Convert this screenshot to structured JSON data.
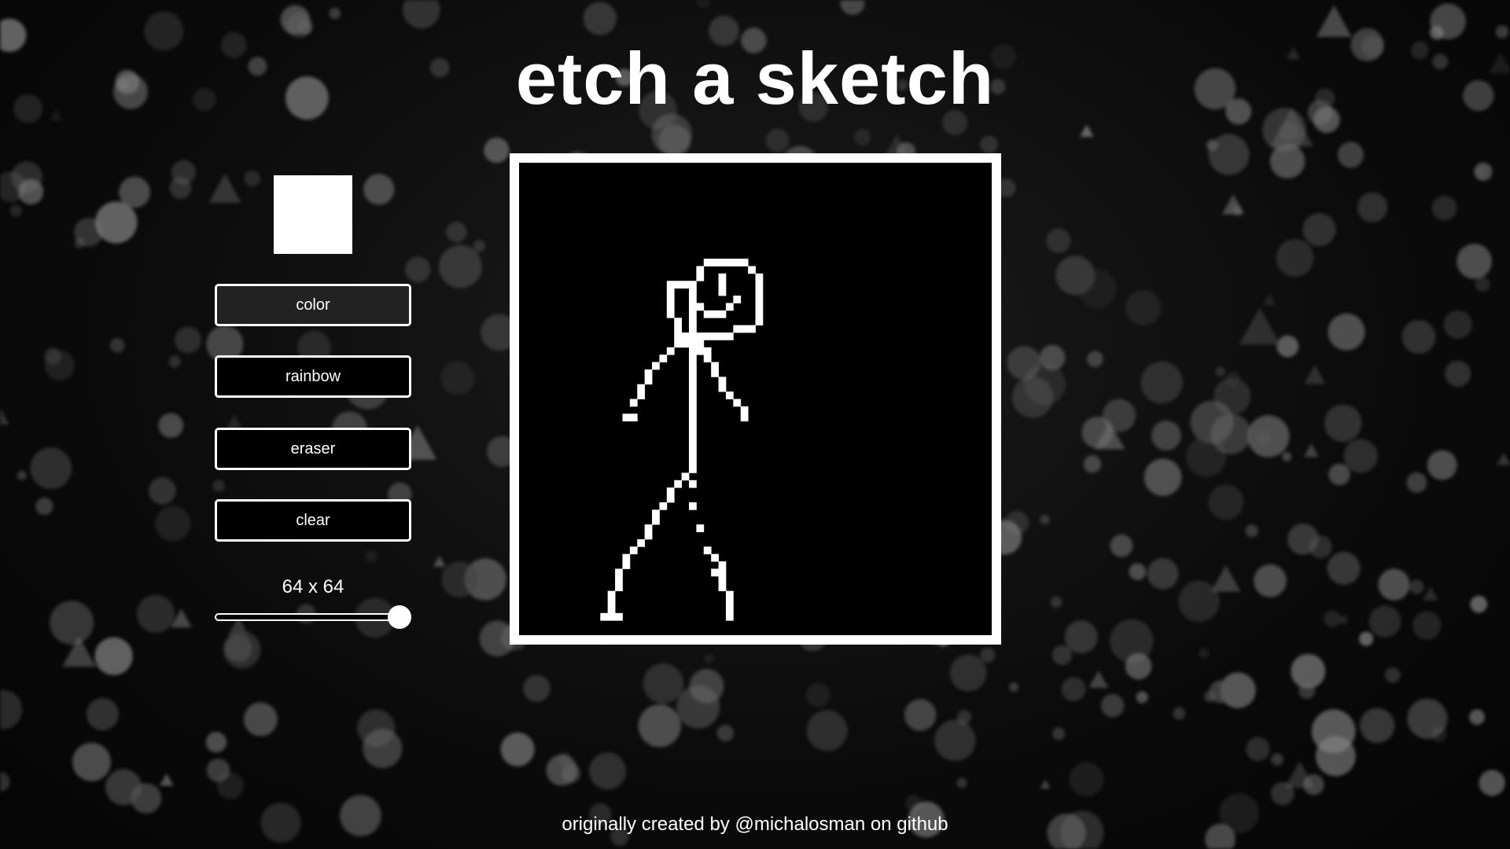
{
  "page": {
    "title": "etch a sketch",
    "footer": "originally created by @michalosman on github"
  },
  "controls": {
    "current_color": "#ffffff",
    "buttons": [
      {
        "id": "color",
        "label": "color",
        "active": true
      },
      {
        "id": "rainbow",
        "label": "rainbow",
        "active": false
      },
      {
        "id": "eraser",
        "label": "eraser",
        "active": false
      },
      {
        "id": "clear",
        "label": "clear",
        "active": false
      }
    ],
    "grid_size_label": "64 x 64",
    "grid_size": {
      "value": 64,
      "min": 1,
      "max": 64
    }
  },
  "board": {
    "background": "#000000",
    "pen_color": "#ffffff",
    "grid": 64
  },
  "theme": {
    "accent": "#ffffff",
    "button_bg": "#000000",
    "active_button_bg": "#222222"
  }
}
